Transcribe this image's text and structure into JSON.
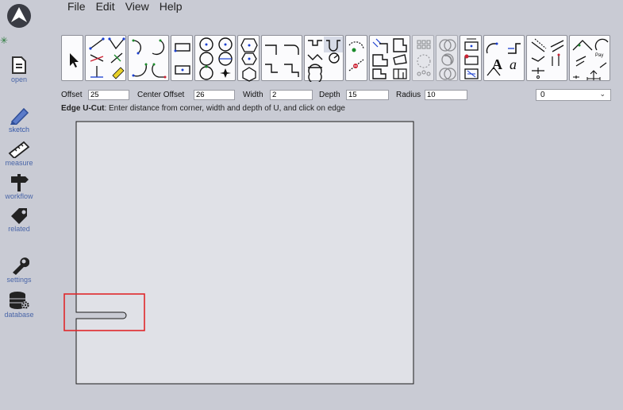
{
  "menu": {
    "items": [
      "File",
      "Edit",
      "View",
      "Help"
    ]
  },
  "sidebar": {
    "items": [
      {
        "label": "open"
      },
      {
        "label": "sketch"
      },
      {
        "label": "measure"
      },
      {
        "label": "workflow"
      },
      {
        "label": "related"
      },
      {
        "label": "settings"
      },
      {
        "label": "database"
      }
    ]
  },
  "toolbar": {
    "text_tool_glyphs": [
      "A",
      "a"
    ],
    "pay_label": "Pay"
  },
  "params": {
    "offset_label": "Offset",
    "offset_value": "25",
    "center_offset_label": "Center Offset",
    "center_offset_value": "26",
    "width_label": "Width",
    "width_value": "2",
    "depth_label": "Depth",
    "depth_value": "15",
    "radius_label": "Radius",
    "radius_value": "10"
  },
  "layer_select": {
    "value": "0"
  },
  "instructions": {
    "tool_name": "Edge U-Cut",
    "text": ": Enter distance from corner, width and depth of U, and click on edge"
  },
  "colors": {
    "background": "#c9cbd4",
    "sidebar_label": "#4a66a8",
    "canvas_paper": "#e0e1e7",
    "highlight_box": "#e0272b"
  }
}
